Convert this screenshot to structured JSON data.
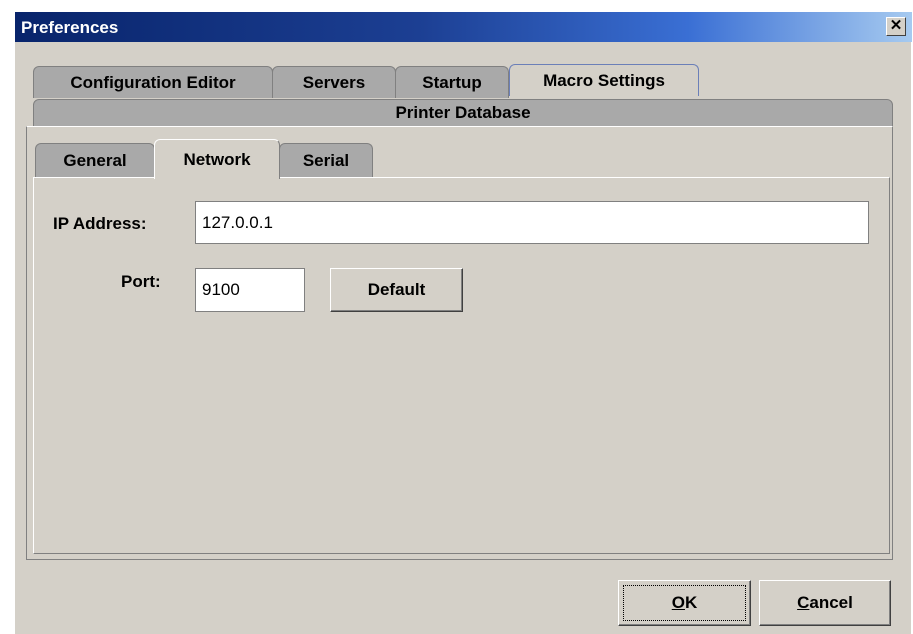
{
  "window": {
    "title": "Preferences",
    "close_glyph": "✕"
  },
  "top_tabs": [
    {
      "label": "Configuration Editor"
    },
    {
      "label": "Servers"
    },
    {
      "label": "Startup"
    },
    {
      "label": "Macro Settings"
    }
  ],
  "printer_tab": {
    "label": "Printer Database"
  },
  "sub_tabs": [
    {
      "label": "General"
    },
    {
      "label": "Network",
      "selected": true
    },
    {
      "label": "Serial"
    }
  ],
  "network": {
    "ip_label": "IP Address:",
    "ip_value": "127.0.0.1",
    "port_label": "Port:",
    "port_value": "9100",
    "default_button": "Default"
  },
  "footer": {
    "ok": {
      "mnemonic": "O",
      "rest": "K"
    },
    "cancel": {
      "mnemonic": "C",
      "rest": "ancel"
    }
  }
}
